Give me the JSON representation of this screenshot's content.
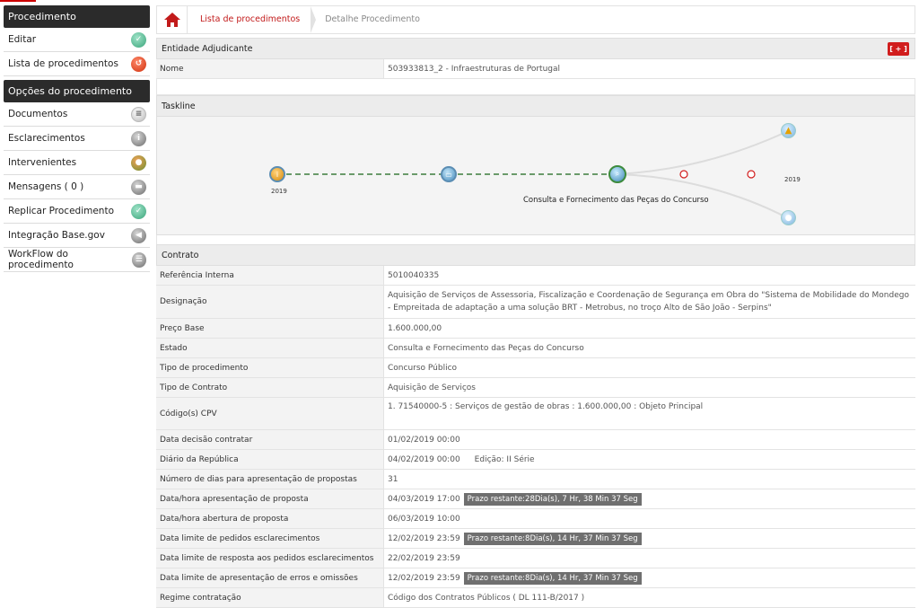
{
  "sidebar": {
    "header1": "Procedimento",
    "items1": [
      {
        "label": "Editar"
      },
      {
        "label": "Lista de procedimentos"
      }
    ],
    "header2": "Opções do procedimento",
    "items2": [
      {
        "label": "Documentos"
      },
      {
        "label": "Esclarecimentos"
      },
      {
        "label": "Intervenientes"
      },
      {
        "label": "Mensagens ( 0 )"
      },
      {
        "label": "Replicar Procedimento"
      },
      {
        "label": "Integração Base.gov"
      },
      {
        "label": "WorkFlow do procedimento"
      }
    ]
  },
  "breadcrumb": {
    "link": "Lista de procedimentos",
    "current": "Detalhe Procedimento"
  },
  "entidade": {
    "title": "Entidade Adjudicante",
    "expand": "[ + ]",
    "nome_label": "Nome",
    "nome_value": "503933813_2 - Infraestruturas de Portugal"
  },
  "taskline": {
    "title": "Taskline",
    "year_start": "2019",
    "year_end": "2019",
    "current_step": "Consulta e Fornecimento das Peças do Concurso"
  },
  "contrato": {
    "title": "Contrato",
    "rows": [
      {
        "label": "Referência Interna",
        "value": "5010040335"
      },
      {
        "label": "Designação",
        "value": "Aquisição de Serviços de Assessoria, Fiscalização e Coordenação de Segurança em Obra do \"Sistema de Mobilidade do Mondego - Empreitada de adaptação a uma solução BRT - Metrobus, no troço Alto de São João - Serpins\""
      },
      {
        "label": "Preço Base",
        "value": "1.600.000,00"
      },
      {
        "label": "Estado",
        "value": "Consulta e Fornecimento das Peças do Concurso"
      },
      {
        "label": "Tipo de procedimento",
        "value": "Concurso Público"
      },
      {
        "label": "Tipo de Contrato",
        "value": "Aquisição de Serviços"
      },
      {
        "label": "Código(s) CPV",
        "value": "1.   71540000-5 : Serviços de gestão de obras : 1.600.000,00 : Objeto Principal"
      },
      {
        "label": "Data decisão contratar",
        "value": "01/02/2019 00:00"
      },
      {
        "label": "Diário da República",
        "value": "04/02/2019 00:00",
        "extra": "Edição: II Série"
      },
      {
        "label": "Número de dias para apresentação de propostas",
        "value": "31"
      },
      {
        "label": "Data/hora apresentação de proposta",
        "value": "04/03/2019 17:00",
        "badge": "Prazo restante:28Dia(s), 7 Hr, 38 Min 37 Seg"
      },
      {
        "label": "Data/hora abertura de proposta",
        "value": "06/03/2019 10:00"
      },
      {
        "label": "Data limite de pedidos esclarecimentos",
        "value": "12/02/2019 23:59",
        "badge": "Prazo restante:8Dia(s), 14 Hr, 37 Min 37 Seg"
      },
      {
        "label": "Data limite de resposta aos pedidos esclarecimentos",
        "value": "22/02/2019 23:59"
      },
      {
        "label": "Data limite de apresentação de erros e omissões",
        "value": "12/02/2019 23:59",
        "badge": "Prazo restante:8Dia(s), 14 Hr, 37 Min 37 Seg"
      },
      {
        "label": "Regime contratação",
        "value": "Código dos Contratos Públicos ( DL 111-B/2017 )"
      }
    ]
  },
  "colors": {
    "accent": "#c21a1a",
    "sidebar_header": "#2b2b2b",
    "badge": "#6f6f6f"
  }
}
